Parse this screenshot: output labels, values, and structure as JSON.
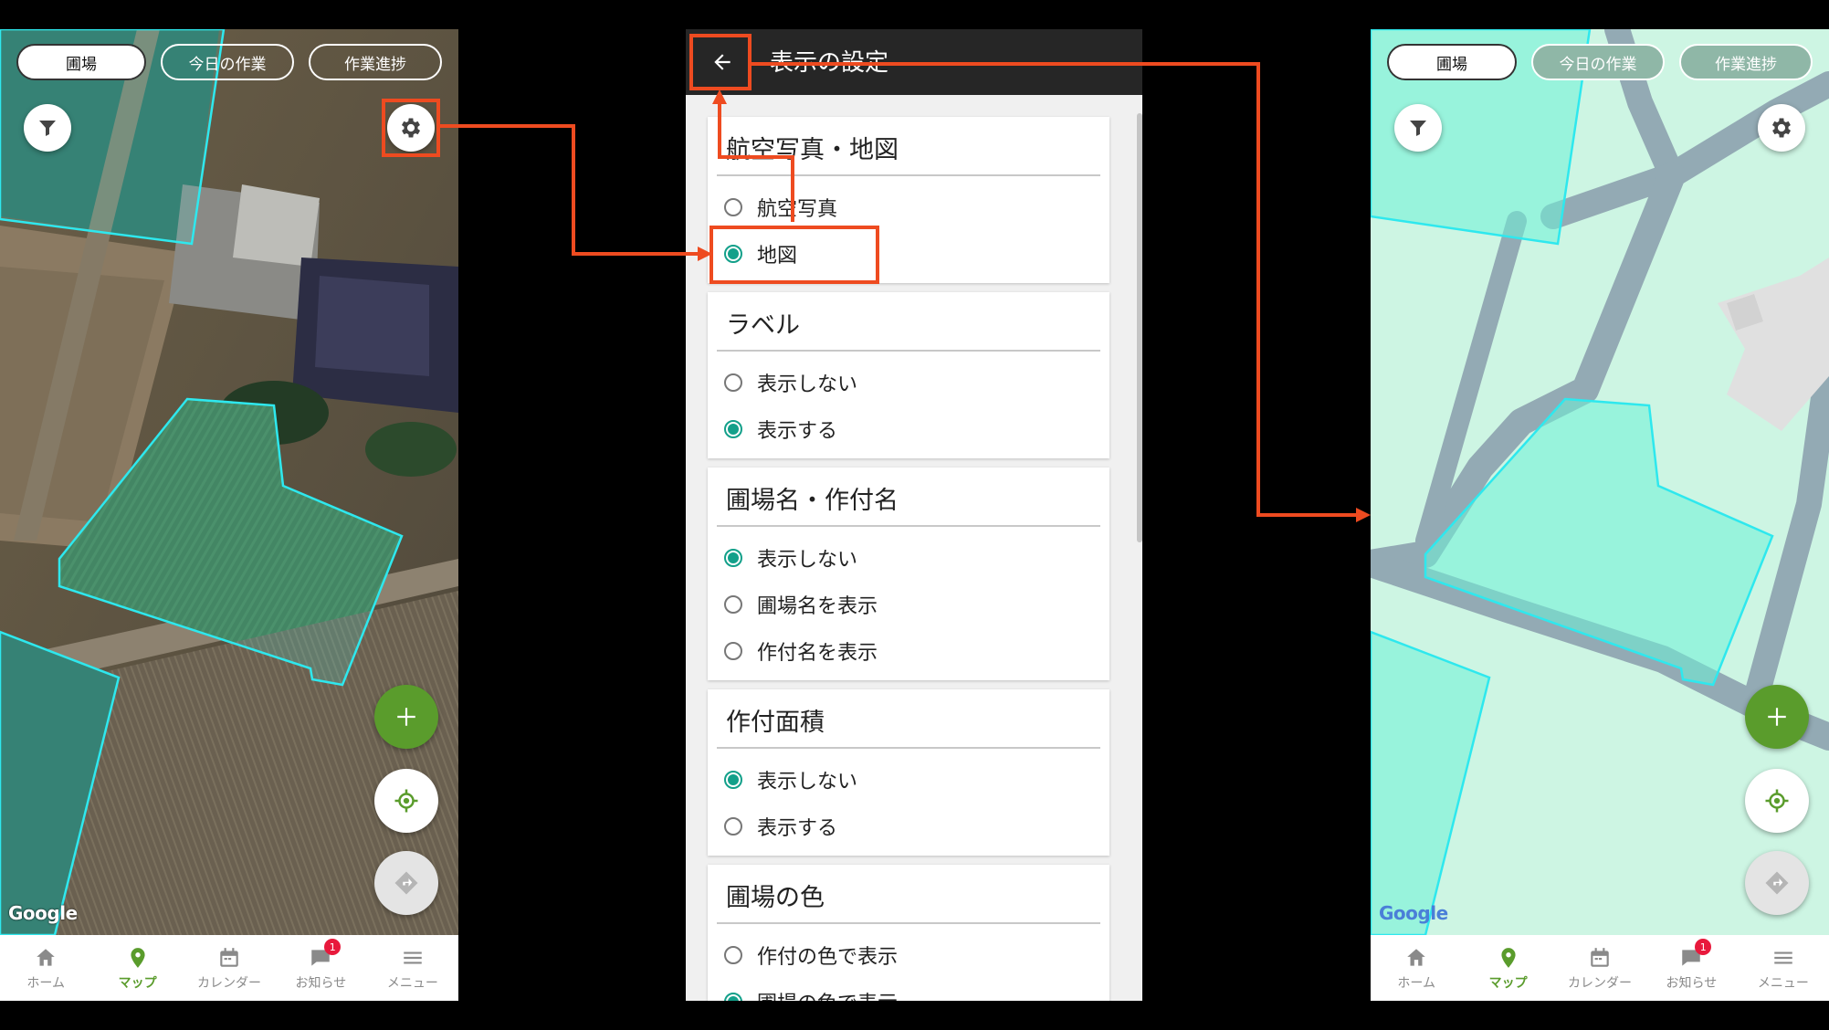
{
  "top_tabs": [
    "圃場",
    "今日の作業",
    "作業進捗"
  ],
  "bottom_nav": [
    {
      "label": "ホーム",
      "icon": "home-icon"
    },
    {
      "label": "マップ",
      "icon": "map-pin-icon"
    },
    {
      "label": "カレンダー",
      "icon": "calendar-icon"
    },
    {
      "label": "お知らせ",
      "icon": "chat-icon",
      "badge": "1"
    },
    {
      "label": "メニュー",
      "icon": "menu-icon"
    }
  ],
  "map_attribution": "Google",
  "settings": {
    "title": "表示の設定",
    "sections": [
      {
        "title": "航空写真・地図",
        "options": [
          "航空写真",
          "地図"
        ],
        "selected": 1
      },
      {
        "title": "ラベル",
        "options": [
          "表示しない",
          "表示する"
        ],
        "selected": 1
      },
      {
        "title": "圃場名・作付名",
        "options": [
          "表示しない",
          "圃場名を表示",
          "作付名を表示"
        ],
        "selected": 0
      },
      {
        "title": "作付面積",
        "options": [
          "表示しない",
          "表示する"
        ],
        "selected": 0
      },
      {
        "title": "圃場の色",
        "options": [
          "作付の色で表示",
          "圃場の色で表示"
        ],
        "selected": 1
      }
    ]
  },
  "colors": {
    "accent_green": "#5a9c2c",
    "radio_teal": "#13a08a",
    "callout": "#ee4b20",
    "field_outline": "#2ee8ee"
  }
}
